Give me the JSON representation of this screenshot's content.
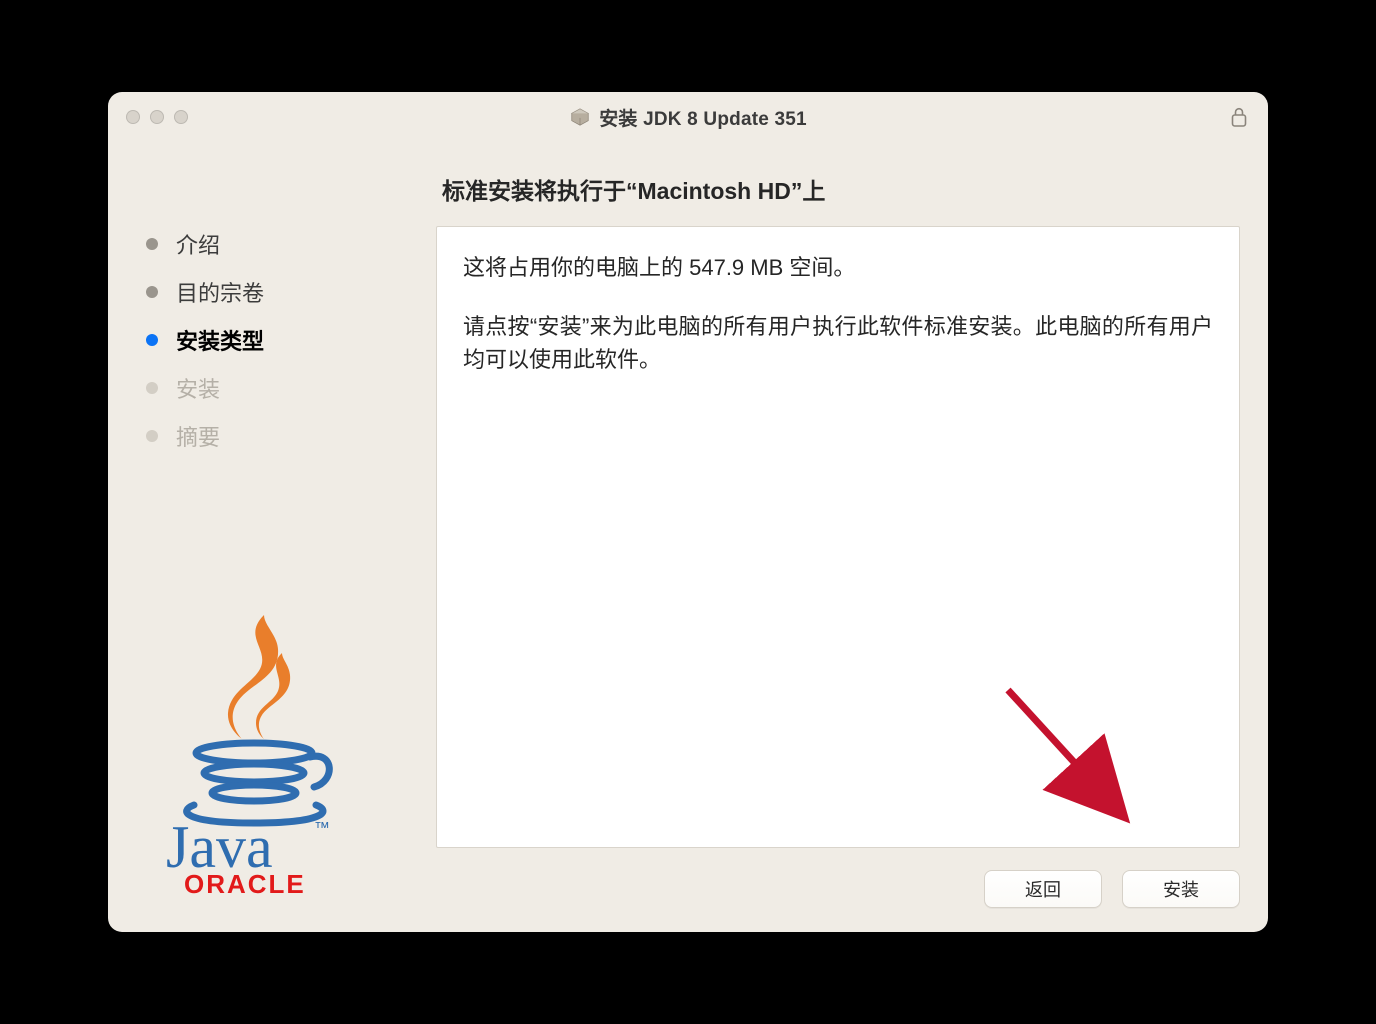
{
  "window": {
    "title": "安装 JDK 8 Update 351"
  },
  "sidebar": {
    "steps": [
      {
        "label": "介绍",
        "state": "done"
      },
      {
        "label": "目的宗卷",
        "state": "done"
      },
      {
        "label": "安装类型",
        "state": "active"
      },
      {
        "label": "安装",
        "state": "pending"
      },
      {
        "label": "摘要",
        "state": "pending"
      }
    ],
    "logo_text_java": "Java",
    "logo_text_tm": "™",
    "logo_text_oracle": "ORACLE"
  },
  "main": {
    "heading": "标准安装将执行于“Macintosh HD”上",
    "line1": "这将占用你的电脑上的 547.9 MB 空间。",
    "line2": "请点按“安装”来为此电脑的所有用户执行此软件标准安装。此电脑的所有用户均可以使用此软件。"
  },
  "buttons": {
    "back": "返回",
    "install": "安装"
  }
}
